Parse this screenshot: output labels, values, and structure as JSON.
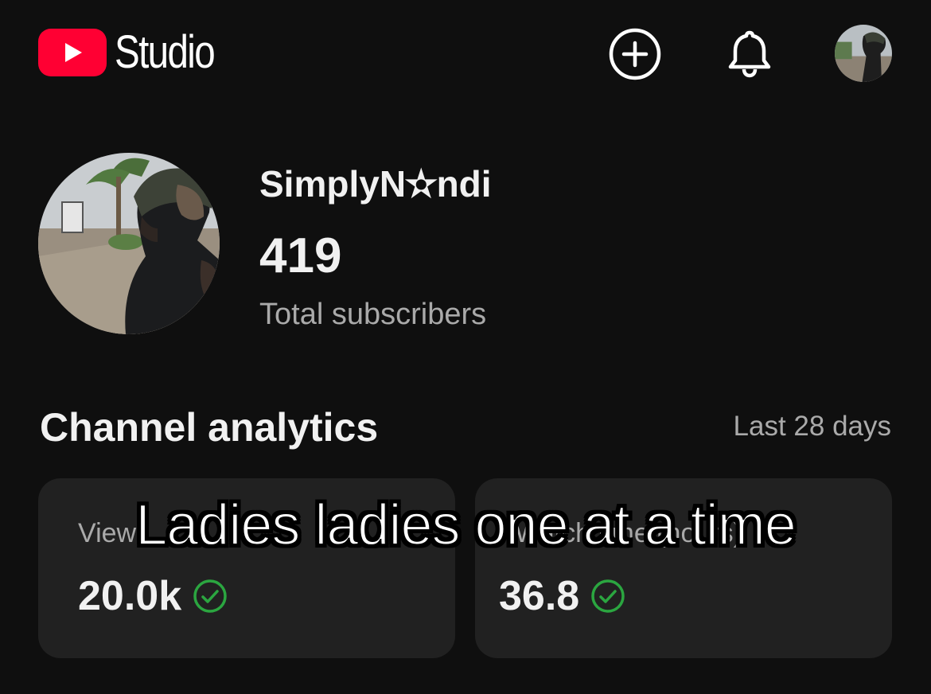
{
  "header": {
    "app_name": "Studio",
    "logo_icon": "youtube-play-icon",
    "create_icon": "create-plus-icon",
    "notifications_icon": "bell-icon",
    "brand_color": "#ff0033"
  },
  "channel": {
    "name": "SimplyN✫ndi",
    "subscriber_count": "419",
    "subscriber_label": "Total subscribers"
  },
  "analytics": {
    "title": "Channel analytics",
    "period": "Last 28 days",
    "cards": [
      {
        "label": "Views",
        "value": "20.0k",
        "status_icon": "check-circle-icon"
      },
      {
        "label": "Watch time (hours)",
        "value": "36.8",
        "status_icon": "check-circle-icon"
      }
    ],
    "status_color": "#2ba640"
  },
  "overlay": {
    "caption": "Ladies ladies one at a time"
  }
}
